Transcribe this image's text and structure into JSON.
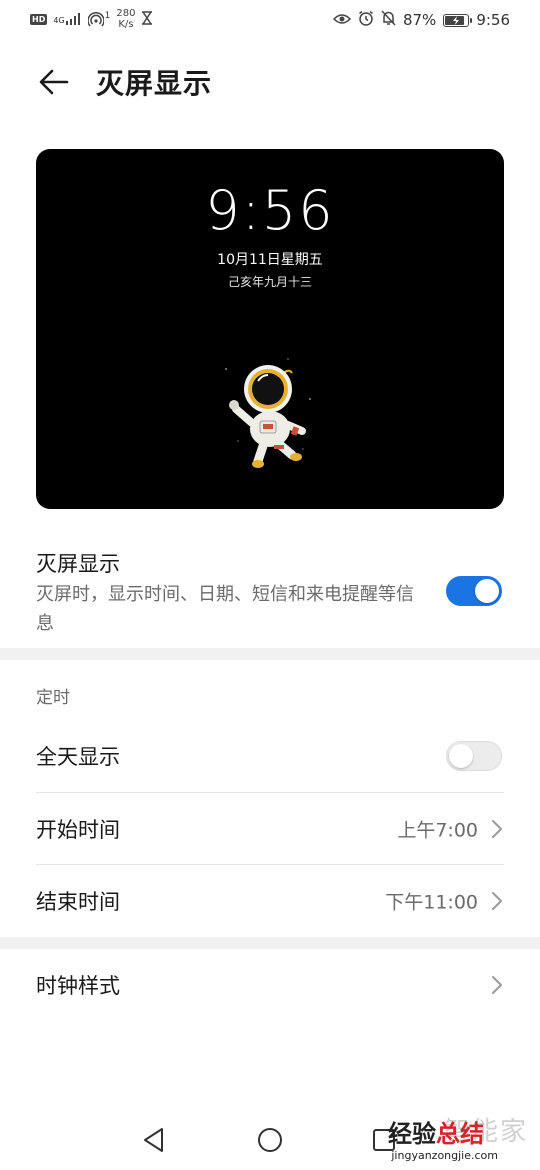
{
  "status_bar": {
    "hd": "HD",
    "network": "4G",
    "hotspot_count": "1",
    "speed_value": "280",
    "speed_unit": "K/s",
    "battery": "87%",
    "time": "9:56",
    "icons": [
      "signal-icon",
      "hotspot-icon",
      "hourglass-icon",
      "eye-icon",
      "alarm-icon",
      "mute-icon",
      "battery-icon"
    ]
  },
  "header": {
    "title": "灭屏显示",
    "back_icon": "back-arrow-icon"
  },
  "preview": {
    "time": "9:56",
    "date": "10月11日星期五",
    "lunar": "己亥年九月十三"
  },
  "aod": {
    "title": "灭屏显示",
    "description": "灭屏时，显示时间、日期、短信和来电提醒等信息",
    "enabled": true
  },
  "schedule": {
    "section_label": "定时",
    "all_day_label": "全天显示",
    "all_day_enabled": false,
    "start_label": "开始时间",
    "start_value": "上午7:00",
    "end_label": "结束时间",
    "end_value": "下午11:00"
  },
  "clock_style": {
    "label": "时钟样式"
  },
  "colors": {
    "accent": "#1b74e4",
    "preview_bg": "#000000"
  },
  "watermark": {
    "top": "智能家",
    "brand_black": "经验",
    "brand_red": "总结",
    "url": "jingyanzongjie.com"
  }
}
